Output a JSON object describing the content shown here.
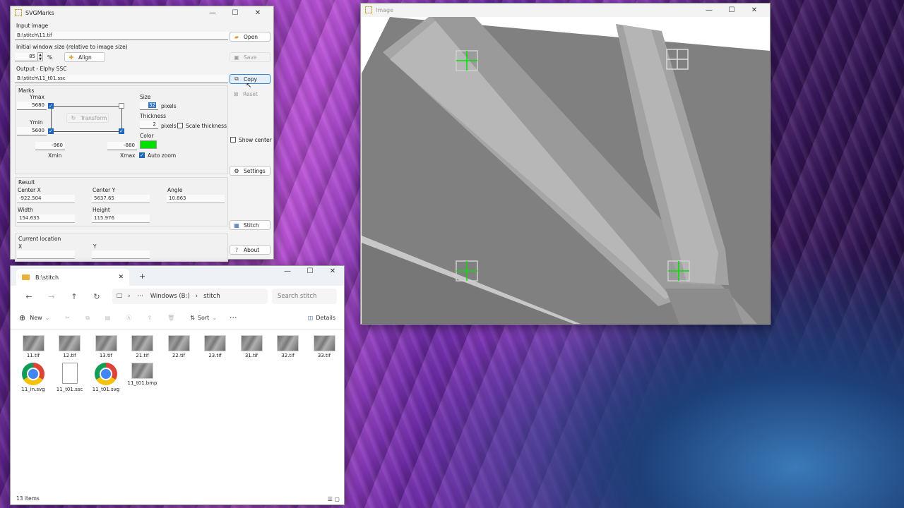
{
  "svgmarks": {
    "title": "SVGMarks",
    "input_label": "Input image",
    "input_value": "B:\\stitch\\11.tif",
    "open_label": "Open",
    "init_size_label": "Initial window size (relative to image size)",
    "init_size_value": "85",
    "percent": "%",
    "align_label": "Align",
    "save_label": "Save",
    "output_label": "Output - Elphy SSC",
    "output_value": "B:\\stitch\\11_t01.ssc",
    "copy_label": "Copy",
    "reset_label": "Reset",
    "marks_label": "Marks",
    "ymax_label": "Ymax",
    "ymax_value": "5680",
    "ymin_label": "Ymin",
    "ymin_value": "5600",
    "transform_label": "Transform",
    "xmin_value": "-960",
    "xmax_value": "-880",
    "xmin_label": "Xmin",
    "xmax_label": "Xmax",
    "size_label": "Size",
    "size_value": "32",
    "pixels": "pixels",
    "thickness_label": "Thickness",
    "thickness_value": "2",
    "scale_thickness_label": "Scale thickness",
    "show_center_label": "Show center",
    "color_label": "Color",
    "mark_color": "#00e000",
    "auto_zoom_label": "Auto zoom",
    "settings_label": "Settings",
    "result_label": "Result",
    "center_x_label": "Center X",
    "center_x_value": "-922.504",
    "center_y_label": "Center Y",
    "center_y_value": "5637.65",
    "angle_label": "Angle",
    "angle_value": "10.863",
    "width_label": "Width",
    "width_value": "154.635",
    "height_label": "Height",
    "height_value": "115.976",
    "stitch_label": "Stitch",
    "current_location_label": "Current location",
    "x_label": "X",
    "y_label": "Y",
    "about_label": "About"
  },
  "image_window": {
    "title": "Image"
  },
  "explorer": {
    "tab_title": "B:\\stitch",
    "breadcrumb": [
      "Windows (B:)",
      "stitch"
    ],
    "search_placeholder": "Search stitch",
    "new_label": "New",
    "sort_label": "Sort",
    "details_label": "Details",
    "files": [
      {
        "name": "11.tif",
        "icon": "image-thumbnail"
      },
      {
        "name": "12.tif",
        "icon": "image-thumbnail"
      },
      {
        "name": "13.tif",
        "icon": "image-thumbnail"
      },
      {
        "name": "21.tif",
        "icon": "image-thumbnail"
      },
      {
        "name": "22.tif",
        "icon": "image-thumbnail"
      },
      {
        "name": "23.tif",
        "icon": "image-thumbnail"
      },
      {
        "name": "31.tif",
        "icon": "image-thumbnail"
      },
      {
        "name": "32.tif",
        "icon": "image-thumbnail"
      },
      {
        "name": "33.tif",
        "icon": "image-thumbnail"
      },
      {
        "name": "11_in.svg",
        "icon": "chrome-icon"
      },
      {
        "name": "11_t01.ssc",
        "icon": "document-icon"
      },
      {
        "name": "11_t01.svg",
        "icon": "chrome-icon"
      },
      {
        "name": "11_t01.bmp",
        "icon": "image-thumbnail"
      }
    ],
    "status": "13 items"
  }
}
